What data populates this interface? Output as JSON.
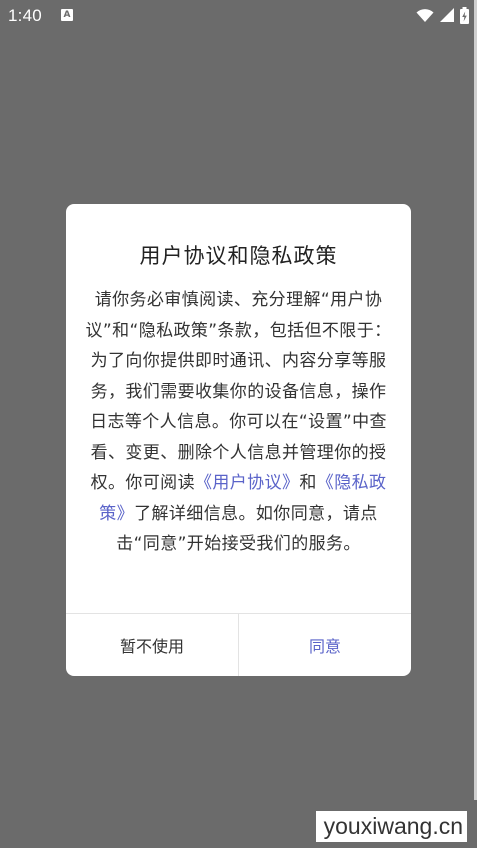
{
  "status_bar": {
    "time": "1:40",
    "app_icon": "A",
    "icons": [
      "wifi-icon",
      "cell-signal-icon",
      "battery-charging-icon"
    ]
  },
  "dialog": {
    "title": "用户协议和隐私政策",
    "body_intro": "请你务必审慎阅读、充分理解“用户协议”和“隐私政策”条款，包括但不限于：为了向你提供即时通讯、内容分享等服务，我们需要收集你的设备信息，操作日志等个人信息。你可以在“设置”中查看、变更、删除个人信息并管理你的授权。你可阅读",
    "link_user_agreement": "《用户协议》",
    "body_and": "和",
    "link_privacy_policy": "《隐私政策》",
    "body_outro": "了解详细信息。如你同意，请点击“同意”开始接受我们的服务。",
    "decline_label": "暂不使用",
    "accept_label": "同意"
  },
  "watermark": "youxiwang.cn",
  "colors": {
    "overlay": "#6b6b6b",
    "link": "#5a63c9",
    "text": "#333333"
  }
}
